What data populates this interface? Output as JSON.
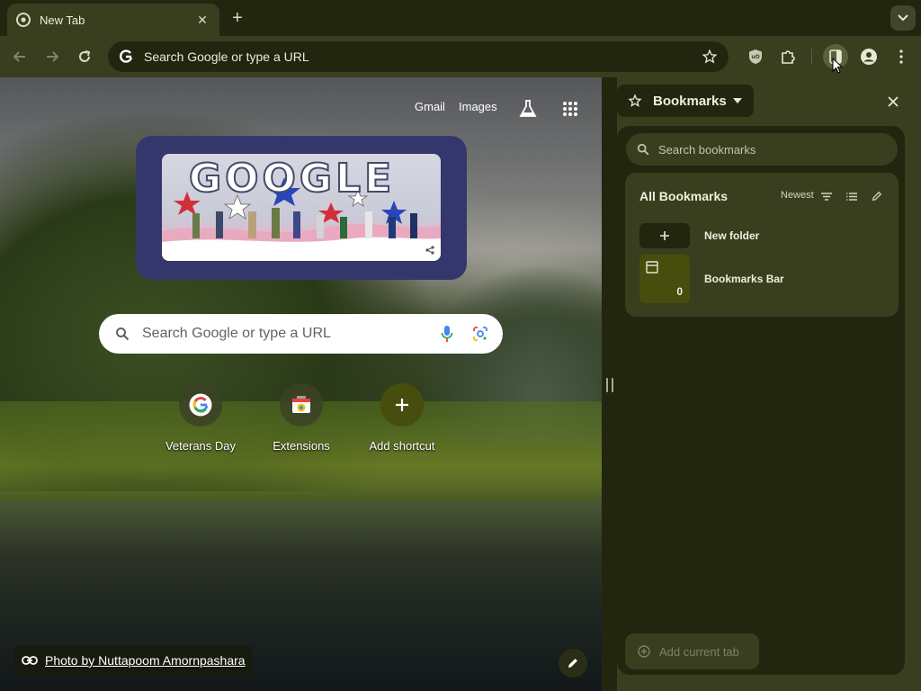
{
  "tab": {
    "title": "New Tab"
  },
  "toolbar": {
    "omnibox_text": "Search Google or type a URL"
  },
  "ntp": {
    "links": {
      "gmail": "Gmail",
      "images": "Images"
    },
    "doodle_text": "GOOGLE",
    "search_placeholder": "Search Google or type a URL",
    "shortcuts": [
      {
        "label": "Veterans Day",
        "icon": "google-g-icon"
      },
      {
        "label": "Extensions",
        "icon": "chrome-extensions-icon"
      },
      {
        "label": "Add shortcut",
        "icon": "plus-icon"
      }
    ],
    "photo_credit": "Photo by Nuttapoom Amornpashara"
  },
  "side_panel": {
    "title": "Bookmarks",
    "search_placeholder": "Search bookmarks",
    "list_heading": "All Bookmarks",
    "sort_label": "Newest",
    "items": [
      {
        "label": "New folder",
        "icon": "plus-icon"
      },
      {
        "label": "Bookmarks Bar",
        "icon": "folder-icon",
        "count": "0"
      }
    ],
    "add_current_tab": "Add current tab"
  },
  "colors": {
    "frame": "#23260f",
    "toolbar": "#393e1f",
    "folder_tile": "#474d0c",
    "doodle_frame": "#33376b"
  }
}
